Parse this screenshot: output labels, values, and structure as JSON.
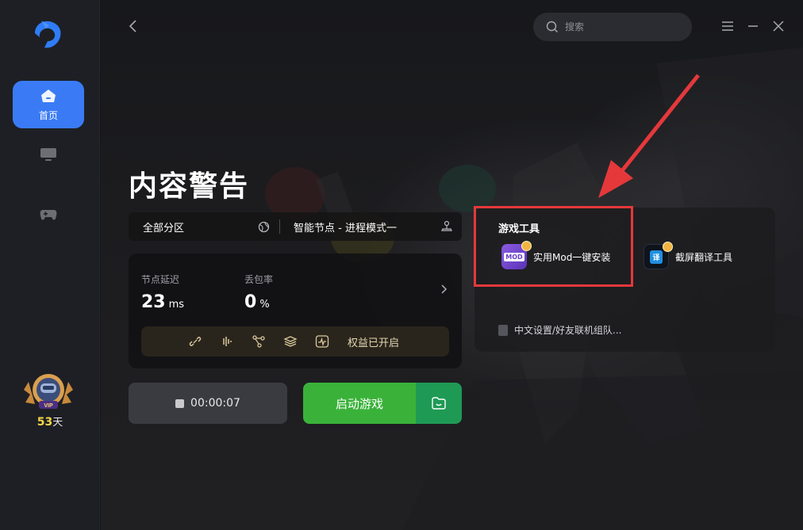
{
  "sidebar": {
    "items": [
      {
        "label": "首页",
        "icon": "home-icon",
        "active": true
      },
      {
        "label": "",
        "icon": "monitor-icon",
        "active": false
      },
      {
        "label": "",
        "icon": "gamepad-icon",
        "active": false
      }
    ],
    "vip": {
      "badge": "VIP",
      "days": "53",
      "unit": "天"
    }
  },
  "header": {
    "search_placeholder": "搜索"
  },
  "game": {
    "title": "内容警告"
  },
  "node_bar": {
    "zone": "全部分区",
    "mode": "智能节点 - 进程模式一"
  },
  "stats": {
    "latency_label": "节点延迟",
    "latency_value": "23",
    "latency_unit": "ms",
    "loss_label": "丢包率",
    "loss_value": "0",
    "loss_unit": "%",
    "benefit_text": "权益已开启"
  },
  "actions": {
    "timer": "00:00:07",
    "launch_label": "启动游戏"
  },
  "tools": {
    "title": "游戏工具",
    "items": [
      {
        "label": "实用Mod一键安装",
        "icon_text": "MOD",
        "color": "#7b4fd6"
      },
      {
        "label": "截屏翻译工具",
        "icon_text": "译",
        "color": "#1f8fe0"
      }
    ],
    "tip": "中文设置/好友联机组队..."
  },
  "colors": {
    "accent": "#3a7bf5",
    "launch": "#3ab23a",
    "folder": "#1f9a55",
    "highlight": "#e5383b"
  }
}
